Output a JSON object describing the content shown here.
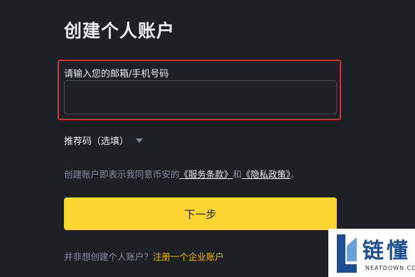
{
  "heading": "创建个人账户",
  "account_field": {
    "label": "请输入您的邮箱/手机号码",
    "value": "",
    "placeholder": ""
  },
  "referral": {
    "label": "推荐码（选填）"
  },
  "terms": {
    "prefix": "创建账户即表示我同意币安的",
    "service_link": "《服务条款》",
    "joiner": "和",
    "privacy_link": "《隐私政策》",
    "suffix": "。"
  },
  "next_button": "下一步",
  "business": {
    "prompt": "并非想创建个人账户？",
    "link": "注册一个企业账户"
  },
  "watermark": {
    "title": "链懂",
    "subtitle": "NEATDOWN.COM"
  },
  "colors": {
    "background": "#1e2026",
    "accent_yellow": "#fcd535",
    "link_yellow": "#f0b90b",
    "highlight_red": "#d6302b"
  }
}
